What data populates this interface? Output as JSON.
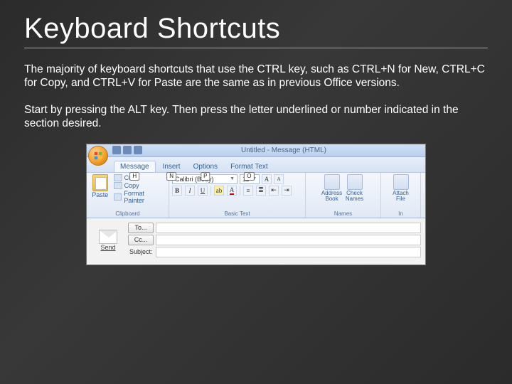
{
  "slide": {
    "title": "Keyboard Shortcuts",
    "para1": "The majority of keyboard shortcuts that use the CTRL key, such as CTRL+N for New, CTRL+C for Copy, and CTRL+V for Paste are the same as in previous Office versions.",
    "para2": "Start by pressing the ALT key. Then press the letter underlined or number indicated in the section desired."
  },
  "window": {
    "title": "Untitled - Message (HTML)"
  },
  "tabs": {
    "message": {
      "label": "Message",
      "key": "H"
    },
    "insert": {
      "label": "Insert",
      "key": "N"
    },
    "options": {
      "label": "Options",
      "key": "P"
    },
    "format": {
      "label": "Format Text",
      "key": "O"
    }
  },
  "ribbon": {
    "clipboard": {
      "paste": "Paste",
      "cut": "Cut",
      "copy": "Copy",
      "painter": "Format Painter",
      "group": "Clipboard"
    },
    "font": {
      "name": "Calibri (Body)",
      "size": "11",
      "group": "Basic Text"
    },
    "names": {
      "address": "Address Book",
      "check": "Check Names",
      "group": "Names"
    },
    "include": {
      "attach": "Attach File",
      "group": "In"
    }
  },
  "compose": {
    "send": "Send",
    "to": "To...",
    "cc": "Cc...",
    "subject": "Subject:"
  }
}
